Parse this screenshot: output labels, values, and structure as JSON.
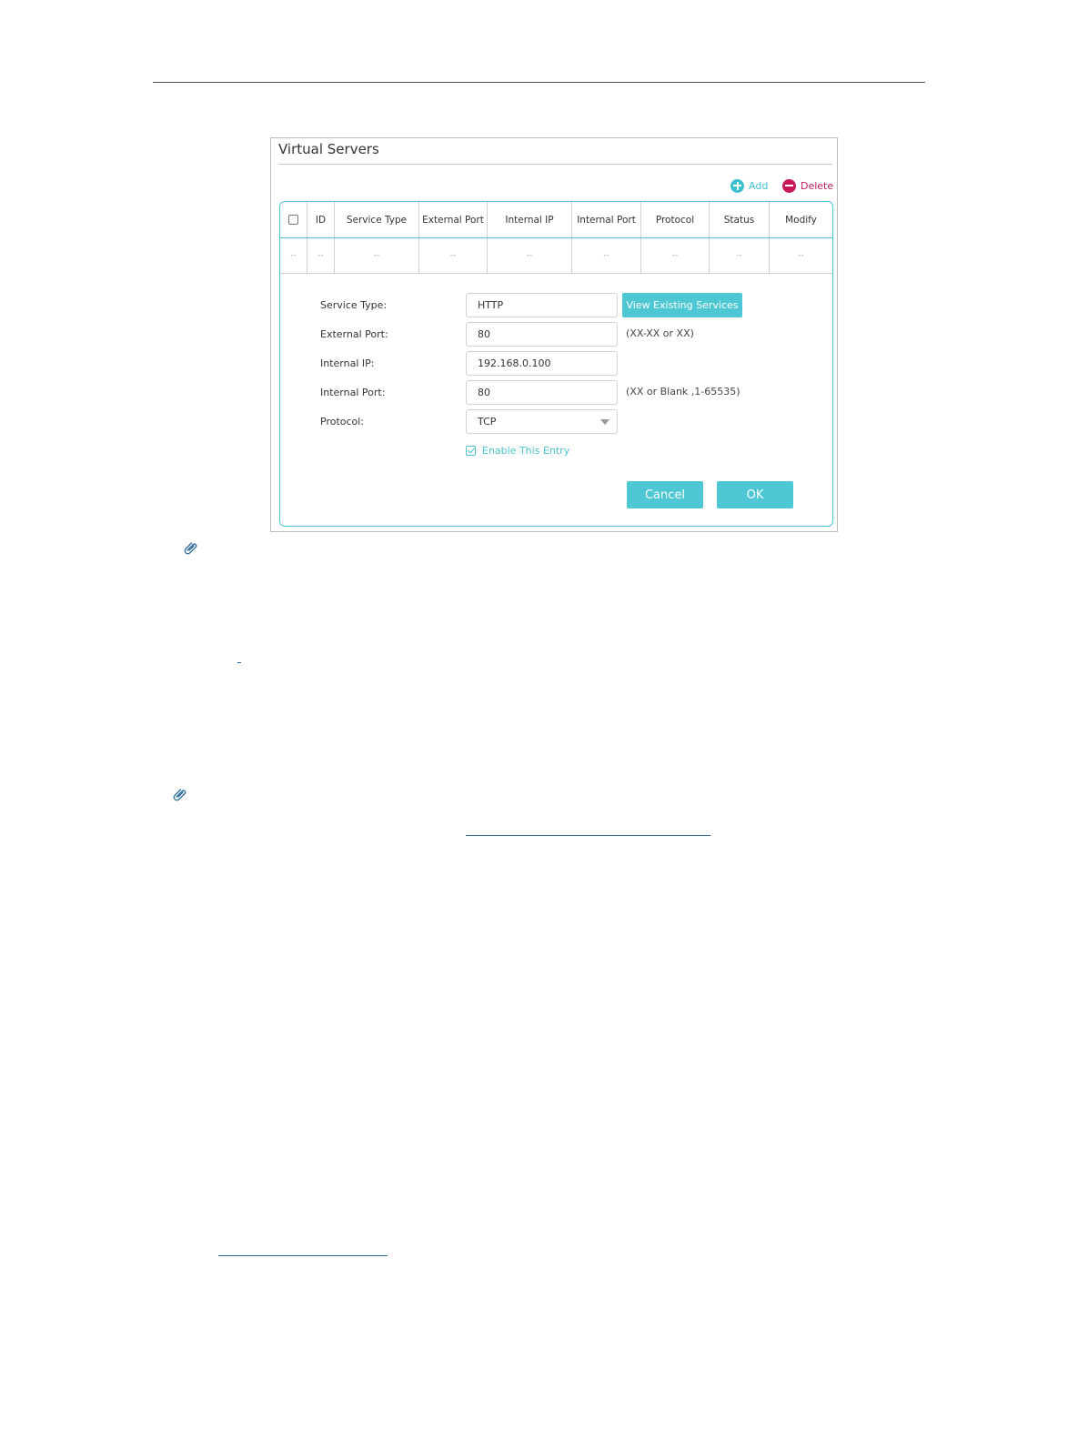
{
  "panel": {
    "title": "Virtual Servers",
    "add_label": "Add",
    "delete_label": "Delete"
  },
  "table": {
    "headers": [
      "",
      "ID",
      "Service Type",
      "External Port",
      "Internal IP",
      "Internal Port",
      "Protocol",
      "Status",
      "Modify"
    ],
    "empty_row": [
      "--",
      "--",
      "--",
      "--",
      "--",
      "--",
      "--",
      "--",
      "--"
    ]
  },
  "form": {
    "service_type_label": "Service Type:",
    "service_type_value": "HTTP",
    "view_services_label": "View Existing Services",
    "external_port_label": "External Port:",
    "external_port_value": "80",
    "external_port_hint": "(XX-XX or XX)",
    "internal_ip_label": "Internal IP:",
    "internal_ip_value": "192.168.0.100",
    "internal_port_label": "Internal Port:",
    "internal_port_value": "80",
    "internal_port_hint": "(XX or Blank ,1-65535)",
    "protocol_label": "Protocol:",
    "protocol_value": "TCP",
    "enable_label": "Enable This Entry",
    "cancel_label": "Cancel",
    "ok_label": "OK"
  },
  "colors": {
    "accent": "#4dc7d3",
    "delete": "#c8185a",
    "note_icon": "#2a6a98"
  }
}
